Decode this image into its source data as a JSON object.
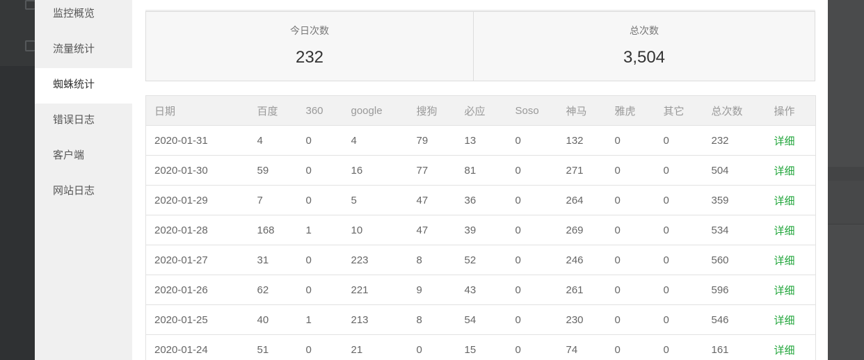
{
  "menu": {
    "items": [
      {
        "label": "监控概览",
        "active": false
      },
      {
        "label": "流量统计",
        "active": false
      },
      {
        "label": "蜘蛛统计",
        "active": true
      },
      {
        "label": "错误日志",
        "active": false
      },
      {
        "label": "客户端",
        "active": false
      },
      {
        "label": "网站日志",
        "active": false
      }
    ]
  },
  "stats": {
    "today": {
      "label": "今日次数",
      "value": "232"
    },
    "total": {
      "label": "总次数",
      "value": "3,504"
    }
  },
  "table": {
    "headers": [
      "日期",
      "百度",
      "360",
      "google",
      "搜狗",
      "必应",
      "Soso",
      "神马",
      "雅虎",
      "其它",
      "总次数",
      "操作"
    ],
    "rows": [
      [
        "2020-01-31",
        "4",
        "0",
        "4",
        "79",
        "13",
        "0",
        "132",
        "0",
        "0",
        "232",
        "详细"
      ],
      [
        "2020-01-30",
        "59",
        "0",
        "16",
        "77",
        "81",
        "0",
        "271",
        "0",
        "0",
        "504",
        "详细"
      ],
      [
        "2020-01-29",
        "7",
        "0",
        "5",
        "47",
        "36",
        "0",
        "264",
        "0",
        "0",
        "359",
        "详细"
      ],
      [
        "2020-01-28",
        "168",
        "1",
        "10",
        "47",
        "39",
        "0",
        "269",
        "0",
        "0",
        "534",
        "详细"
      ],
      [
        "2020-01-27",
        "31",
        "0",
        "223",
        "8",
        "52",
        "0",
        "246",
        "0",
        "0",
        "560",
        "详细"
      ],
      [
        "2020-01-26",
        "62",
        "0",
        "221",
        "9",
        "43",
        "0",
        "261",
        "0",
        "0",
        "596",
        "详细"
      ],
      [
        "2020-01-25",
        "40",
        "1",
        "213",
        "8",
        "54",
        "0",
        "230",
        "0",
        "0",
        "546",
        "详细"
      ],
      [
        "2020-01-24",
        "51",
        "0",
        "21",
        "0",
        "15",
        "0",
        "74",
        "0",
        "0",
        "161",
        "详细"
      ]
    ]
  },
  "colors": {
    "accent": "#20a53a",
    "menu_bg": "#f0f0f0",
    "overlay": "#3b3d3f"
  }
}
